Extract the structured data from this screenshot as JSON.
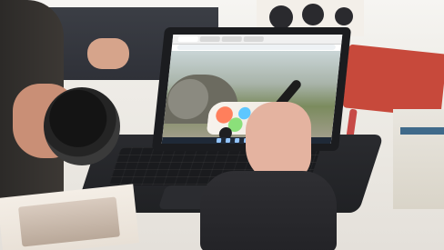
{
  "scene": {
    "accent_colors": {
      "laptop": "#1b1c1f",
      "car_pattern": [
        "#ff7f5c",
        "#5ec7ff",
        "#ffd44a",
        "#8be07a"
      ],
      "books": "#c7493b",
      "pen": "#c74a47"
    },
    "icons": {
      "browser-tabs": "tab-strip",
      "taskbar": "taskbar-icons",
      "stylus": "stylus"
    }
  }
}
